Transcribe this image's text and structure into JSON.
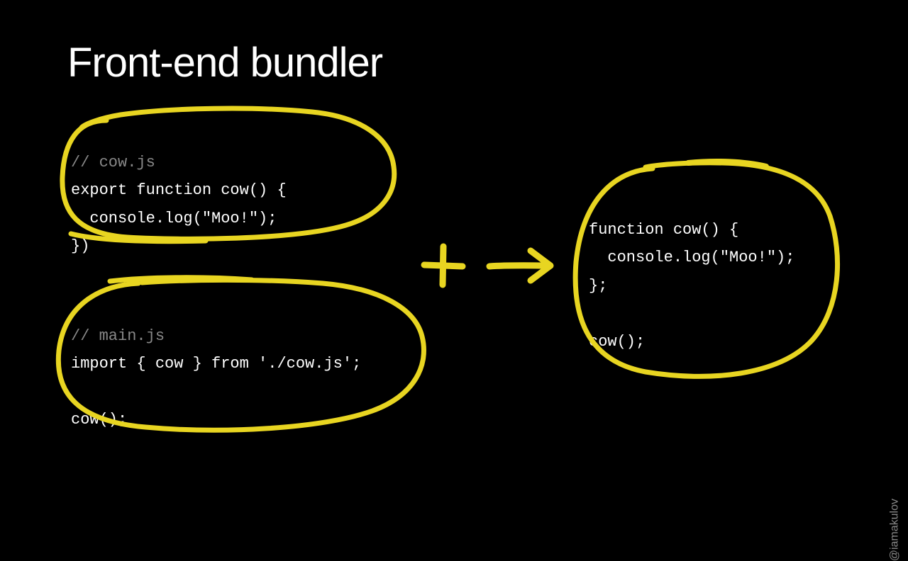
{
  "title": "Front-end bundler",
  "handle": "@iamakulov",
  "colors": {
    "accent": "#e8d521",
    "background": "#000000",
    "text": "#ffffff",
    "comment": "#888888"
  },
  "blocks": {
    "cow": {
      "comment": "// cow.js",
      "line1": "export function cow() {",
      "line2": "  console.log(\"Moo!\");",
      "line3": "})"
    },
    "main": {
      "comment": "// main.js",
      "line1": "import { cow } from './cow.js';",
      "line2": "",
      "line3": "cow();"
    },
    "output": {
      "line1": "function cow() {",
      "line2": "  console.log(\"Moo!\");",
      "line3": "};",
      "line4": "",
      "line5": "cow();"
    }
  }
}
